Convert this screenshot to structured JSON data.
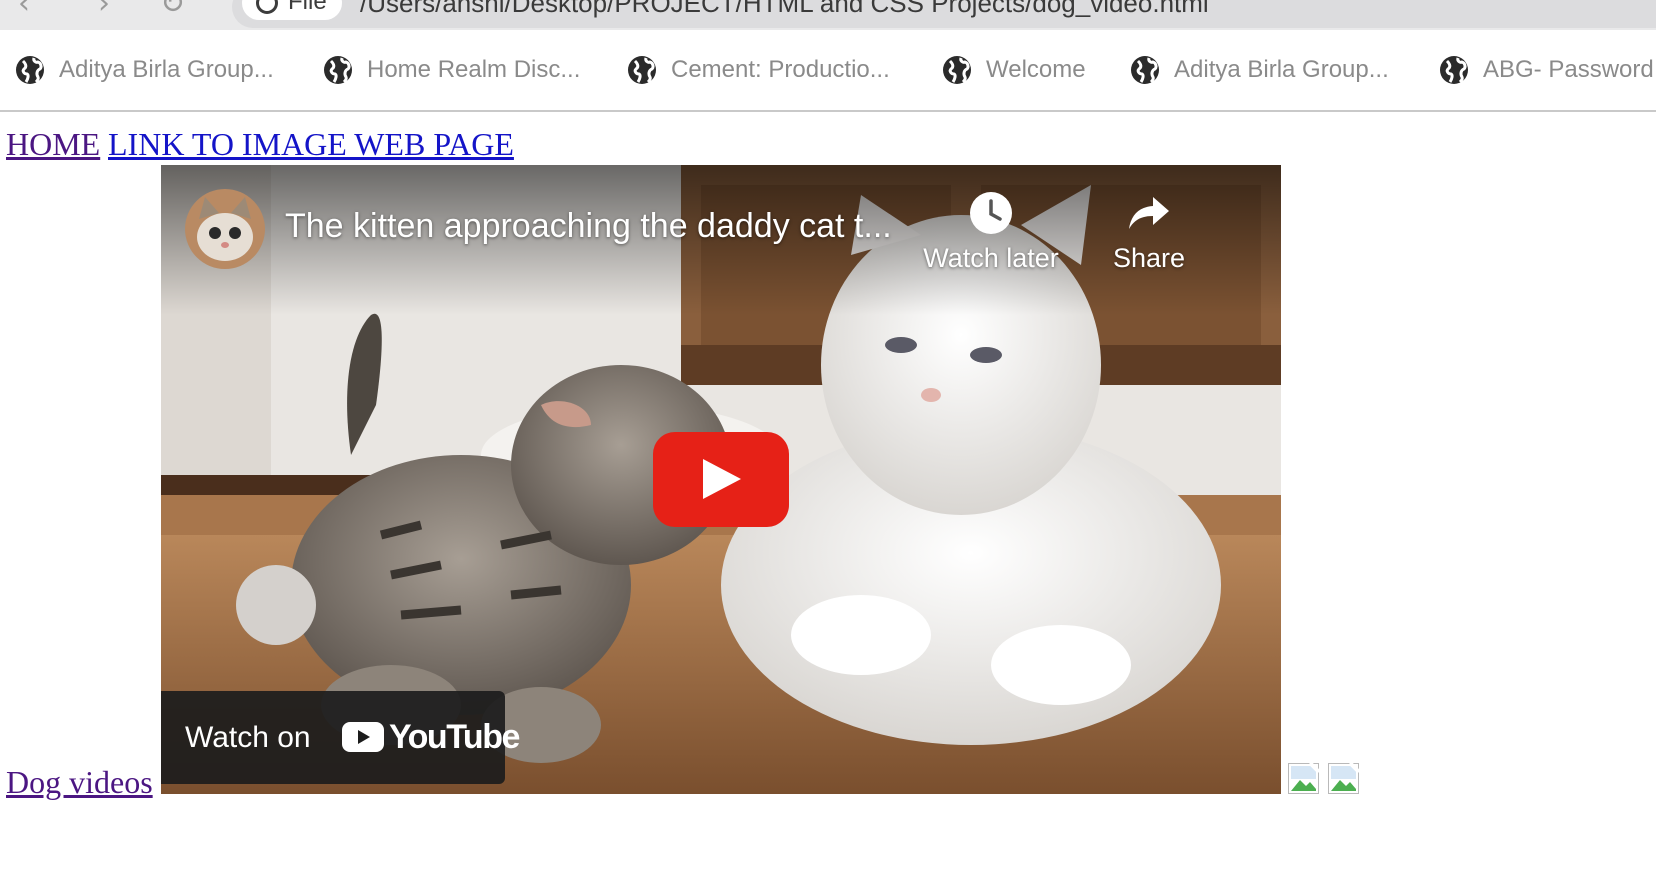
{
  "browser": {
    "address_bar": {
      "scheme_chip": "File",
      "url": "/Users/anshi/Desktop/PROJECT/HTML and CSS Projects/dog_video.html"
    },
    "bookmarks": [
      {
        "label": "Aditya Birla Group..."
      },
      {
        "label": "Home Realm Disc..."
      },
      {
        "label": "Cement: Productio..."
      },
      {
        "label": "Welcome"
      },
      {
        "label": "Aditya Birla Group..."
      },
      {
        "label": "ABG- Password"
      }
    ]
  },
  "page": {
    "nav_links": {
      "home": "HOME",
      "image_page": "LINK TO IMAGE WEB PAGE"
    },
    "bottom_link": "Dog videos",
    "video": {
      "title": "The kitten approaching the daddy cat t...",
      "watch_later_label": "Watch later",
      "share_label": "Share",
      "watch_on_label": "Watch on",
      "youtube_wordmark": "YouTube"
    }
  },
  "colors": {
    "visited_link": "#4b1682",
    "unvisited_link": "#1414c8",
    "youtube_red": "#e62117"
  }
}
